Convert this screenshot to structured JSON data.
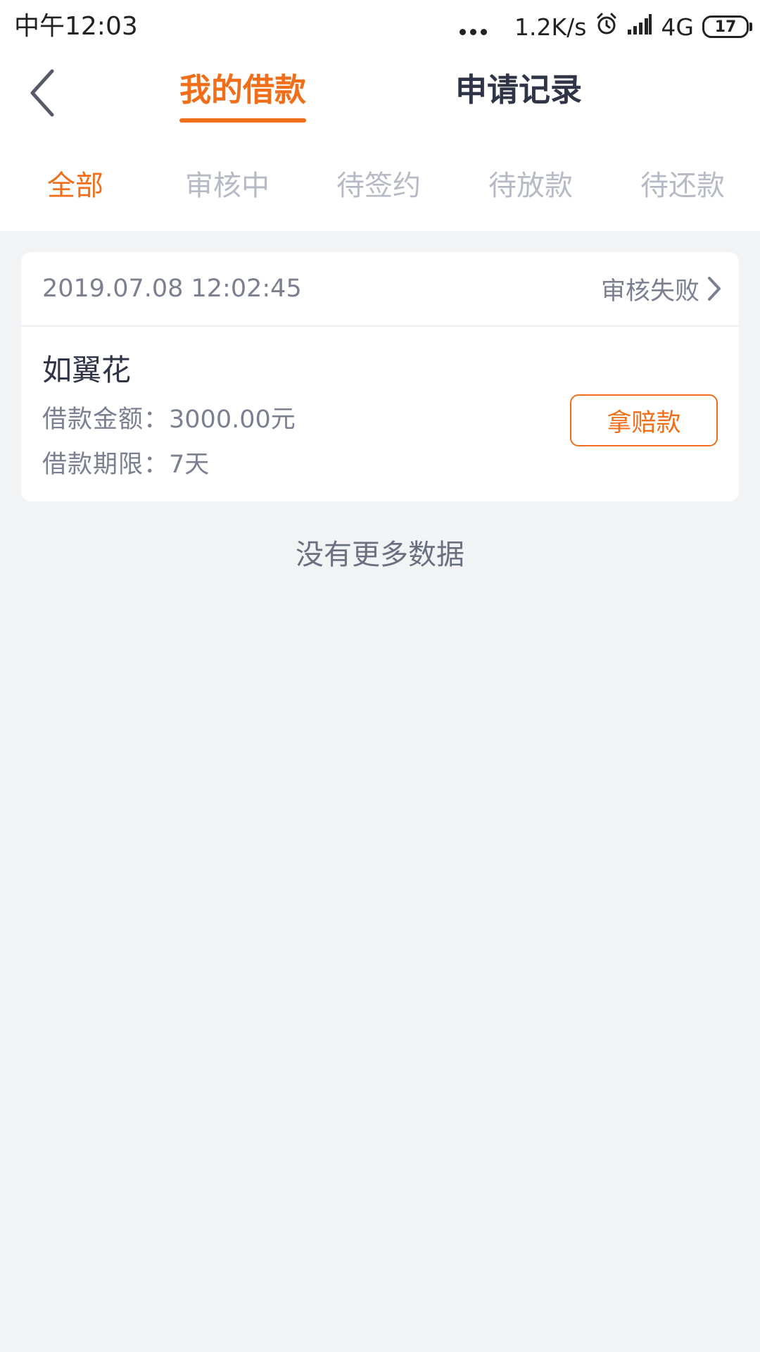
{
  "status_bar": {
    "time": "中午12:03",
    "net_speed": "1.2K/s",
    "network": "4G",
    "battery": "17"
  },
  "header": {
    "tabs": [
      {
        "label": "我的借款",
        "active": true
      },
      {
        "label": "申请记录",
        "active": false
      }
    ]
  },
  "filters": [
    {
      "label": "全部",
      "active": true
    },
    {
      "label": "审核中",
      "active": false
    },
    {
      "label": "待签约",
      "active": false
    },
    {
      "label": "待放款",
      "active": false
    },
    {
      "label": "待还款",
      "active": false
    }
  ],
  "loan_card": {
    "datetime": "2019.07.08 12:02:45",
    "status": "审核失败",
    "product_name": "如翼花",
    "amount_label": "借款金额：",
    "amount_value": "3000.00元",
    "term_label": "借款期限：",
    "term_value": "7天",
    "action_label": "拿赔款"
  },
  "footer_text": "没有更多数据",
  "colors": {
    "accent": "#f06d1a",
    "background": "#f2f3f5",
    "text_primary": "#2f3447",
    "text_secondary": "#7b8090",
    "tab_inactive": "#b6bac4"
  },
  "icons": {
    "back": "chevron-left-icon",
    "status_arrow": "chevron-right-icon",
    "alarm": "alarm-clock-icon",
    "signal": "signal-bars-icon",
    "battery": "battery-icon",
    "more": "more-dots-icon"
  }
}
